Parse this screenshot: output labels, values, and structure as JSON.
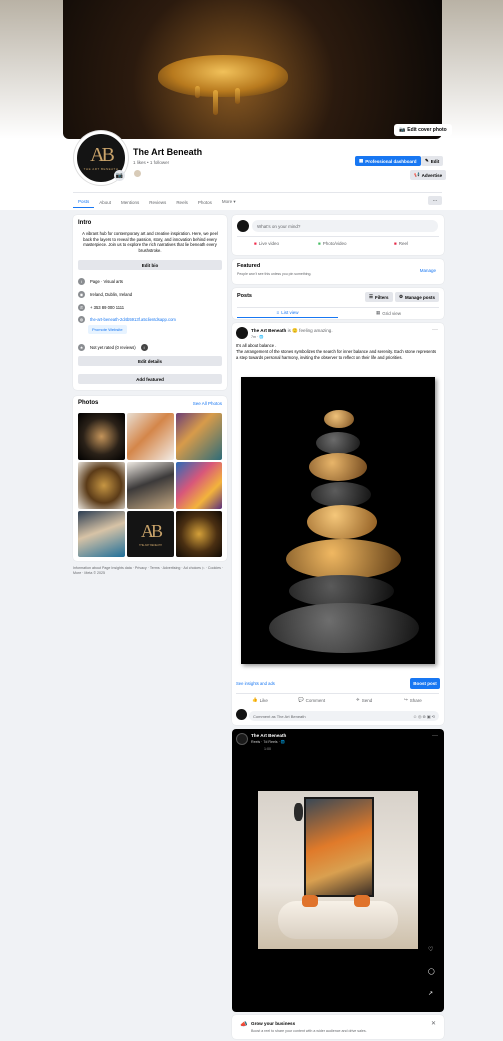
{
  "page": {
    "name": "The Art Beneath",
    "likes": "1 likes • 1 follower",
    "avatar_monogram": "AB",
    "avatar_sub": "THE ART BENEATH",
    "edit_cover": "Edit cover photo",
    "professional_dashboard": "Professional dashboard",
    "edit": "Edit",
    "advertise": "Advertise",
    "more_dots": "···"
  },
  "tabs": [
    "Posts",
    "About",
    "Mentions",
    "Reviews",
    "Reels",
    "Photos",
    "More ▾"
  ],
  "intro": {
    "title": "Intro",
    "bio": "A vibrant hub for contemporary art and creative inspiration. Here, we peel back the layers to reveal the passion, story, and innovation behind every masterpiece. Join us to explore the rich narratives that lie beneath every brushstroke.",
    "edit_bio": "Edit bio",
    "category": "Page · Visual arts",
    "location": "Ireland, Dublin, Ireland",
    "phone": "+ 353 89 000 1111",
    "website": "the-art-beneath-2d4b5913f.a5clientdsapp.com",
    "promote": "Promote Website",
    "rating": "Not yet rated (0 reviews)",
    "edit_details": "Edit details",
    "add_featured": "Add featured"
  },
  "photos": {
    "title": "Photos",
    "see_all": "See All Photos"
  },
  "footer": "Information about Page Insights data · Privacy · Terms · Advertising · Ad choices ▷ · Cookies · More · Meta © 2025",
  "composer": {
    "placeholder": "What's on your mind?",
    "live_video": "Live video",
    "photo_video": "Photo/video",
    "reel": "Reel"
  },
  "featured": {
    "title": "Featured",
    "desc": "People won't see this unless you pin something.",
    "manage": "Manage"
  },
  "posts_header": {
    "title": "Posts",
    "filters": "Filters",
    "manage_posts": "Manage posts",
    "list_view": "List view",
    "grid_view": "Grid view"
  },
  "post1": {
    "author": "The Art Beneath",
    "feeling": "is 🙂 feeling amazing.",
    "time": "7m · 🌐",
    "line1": "It's all about balance .",
    "line2": "The arrangement of the stones symbolizes the search for inner balance and serenity. Each stone represents a step towards personal harmony, inviting the observer to reflect on their life and priorities.",
    "insights": "See insights and ads",
    "boost": "Boost post",
    "like": "Like",
    "comment": "Comment",
    "send": "Send",
    "share": "Share",
    "comment_placeholder": "Comment as The Art Beneath"
  },
  "post2": {
    "author": "The Art Beneath",
    "meta": "Reels · 7d Reels · 🌐",
    "sub": "1:00"
  },
  "boost_banner": {
    "title": "Grow your business",
    "desc": "Boost a reel to share your content with a wider audience and drive sales."
  }
}
